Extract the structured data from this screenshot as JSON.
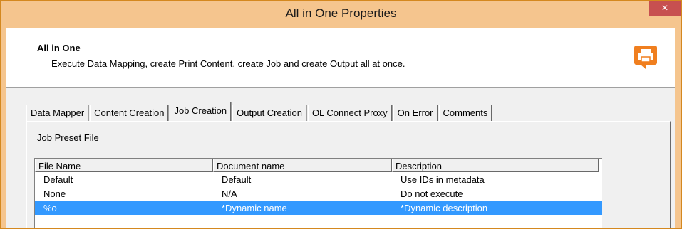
{
  "window": {
    "title": "All in One Properties",
    "close_label": "×"
  },
  "header": {
    "title": "All in One",
    "description": "Execute Data Mapping, create Print Content, create Job and create Output all at once.",
    "icon": "printer-icon"
  },
  "tabs": [
    {
      "label": "Data Mapper",
      "active": false
    },
    {
      "label": "Content Creation",
      "active": false
    },
    {
      "label": "Job Creation",
      "active": true
    },
    {
      "label": "Output Creation",
      "active": false
    },
    {
      "label": "OL Connect Proxy",
      "active": false
    },
    {
      "label": "On Error",
      "active": false
    },
    {
      "label": "Comments",
      "active": false
    }
  ],
  "job_creation": {
    "group_label": "Job Preset File",
    "columns": [
      "File Name",
      "Document name",
      "Description"
    ],
    "rows": [
      {
        "file_name": "Default",
        "document_name": "Default",
        "description": "Use IDs in metadata",
        "selected": false
      },
      {
        "file_name": "None",
        "document_name": "N/A",
        "description": "Do not execute",
        "selected": false
      },
      {
        "file_name": "%o",
        "document_name": "*Dynamic name",
        "description": "*Dynamic description",
        "selected": true
      }
    ]
  },
  "colors": {
    "title_bar": "#f5c58e",
    "close_button": "#c75050",
    "selection": "#3399ff",
    "icon_orange": "#f07f1f"
  }
}
